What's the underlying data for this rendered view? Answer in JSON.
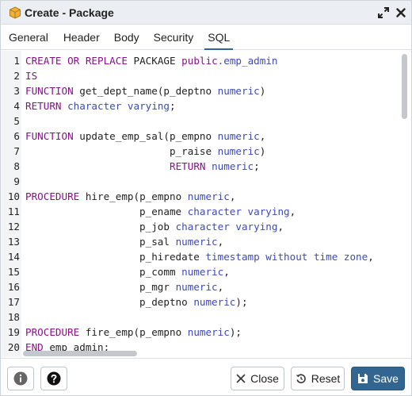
{
  "window": {
    "title": "Create - Package",
    "icons": {
      "title": "package-icon",
      "expand": "expand-icon",
      "close": "close-icon"
    }
  },
  "tabs": [
    {
      "label": "General"
    },
    {
      "label": "Header"
    },
    {
      "label": "Body"
    },
    {
      "label": "Security"
    },
    {
      "label": "SQL",
      "active": true
    }
  ],
  "editor": {
    "lines": [
      {
        "n": "1",
        "tokens": [
          [
            "kw",
            "CREATE OR REPLACE"
          ],
          [
            "",
            "PACKAGE "
          ],
          [
            "kw",
            "public"
          ],
          [
            "ty",
            ".emp_admin"
          ]
        ]
      },
      {
        "n": "2",
        "tokens": [
          [
            "kw",
            "IS"
          ]
        ]
      },
      {
        "n": "3",
        "tokens": [
          [
            "kw",
            "FUNCTION"
          ],
          [
            "",
            "get_dept_name(p_deptno "
          ],
          [
            "ty",
            "numeric"
          ],
          [
            "",
            ")"
          ]
        ]
      },
      {
        "n": "4",
        "tokens": [
          [
            "kw",
            "RETURN"
          ],
          [
            "ty",
            " character varying"
          ],
          [
            "",
            ";"
          ]
        ]
      },
      {
        "n": "5",
        "tokens": []
      },
      {
        "n": "6",
        "tokens": [
          [
            "kw",
            "FUNCTION"
          ],
          [
            "",
            "update_emp_sal(p_empno "
          ],
          [
            "ty",
            "numeric"
          ],
          [
            "",
            ","
          ]
        ]
      },
      {
        "n": "7",
        "tokens": [
          [
            "",
            "                        p_raise "
          ],
          [
            "ty",
            "numeric"
          ],
          [
            "",
            ")"
          ]
        ]
      },
      {
        "n": "8",
        "tokens": [
          [
            "",
            "                        "
          ],
          [
            "kw",
            "RETURN"
          ],
          [
            "ty",
            " numeric"
          ],
          [
            "",
            ";"
          ]
        ]
      },
      {
        "n": "9",
        "tokens": []
      },
      {
        "n": "10",
        "tokens": [
          [
            "kw",
            "PROCEDURE"
          ],
          [
            "",
            "hire_emp(p_empno "
          ],
          [
            "ty",
            "numeric"
          ],
          [
            "",
            ","
          ]
        ]
      },
      {
        "n": "11",
        "tokens": [
          [
            "",
            "                   p_ename "
          ],
          [
            "ty",
            "character varying"
          ],
          [
            "",
            ","
          ]
        ]
      },
      {
        "n": "12",
        "tokens": [
          [
            "",
            "                   p_job "
          ],
          [
            "ty",
            "character varying"
          ],
          [
            "",
            ","
          ]
        ]
      },
      {
        "n": "13",
        "tokens": [
          [
            "",
            "                   p_sal "
          ],
          [
            "ty",
            "numeric"
          ],
          [
            "",
            ","
          ]
        ]
      },
      {
        "n": "14",
        "tokens": [
          [
            "",
            "                   p_hiredate "
          ],
          [
            "ty",
            "timestamp without time zone"
          ],
          [
            "",
            ","
          ]
        ]
      },
      {
        "n": "15",
        "tokens": [
          [
            "",
            "                   p_comm "
          ],
          [
            "ty",
            "numeric"
          ],
          [
            "",
            ","
          ]
        ]
      },
      {
        "n": "16",
        "tokens": [
          [
            "",
            "                   p_mgr "
          ],
          [
            "ty",
            "numeric"
          ],
          [
            "",
            ","
          ]
        ]
      },
      {
        "n": "17",
        "tokens": [
          [
            "",
            "                   p_deptno "
          ],
          [
            "ty",
            "numeric"
          ],
          [
            "",
            ");"
          ]
        ]
      },
      {
        "n": "18",
        "tokens": []
      },
      {
        "n": "19",
        "tokens": [
          [
            "kw",
            "PROCEDURE"
          ],
          [
            "",
            "fire_emp(p_empno "
          ],
          [
            "ty",
            "numeric"
          ],
          [
            "",
            ");"
          ]
        ]
      },
      {
        "n": "20",
        "tokens": [
          [
            "kw",
            "END"
          ],
          [
            "",
            " emp_admin;"
          ]
        ]
      }
    ]
  },
  "footer": {
    "info_icon": "info-icon",
    "help_icon": "help-icon",
    "close_label": "Close",
    "reset_label": "Reset",
    "save_label": "Save"
  },
  "colors": {
    "keyword": "#8a0f8a",
    "type": "#3d4ab8",
    "accent": "#326690",
    "titlebar": "#ebeef3"
  }
}
